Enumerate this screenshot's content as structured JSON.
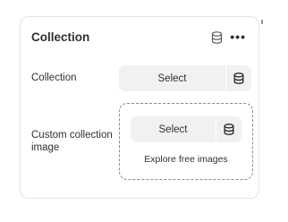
{
  "card": {
    "title": "Collection",
    "header_icon": "database-icon",
    "more_label": "•••"
  },
  "collection_row": {
    "label": "Collection",
    "select_label": "Select",
    "icon": "database-icon"
  },
  "image_row": {
    "label": "Custom collection image",
    "select_label": "Select",
    "icon": "database-icon",
    "explore_label": "Explore free images"
  }
}
